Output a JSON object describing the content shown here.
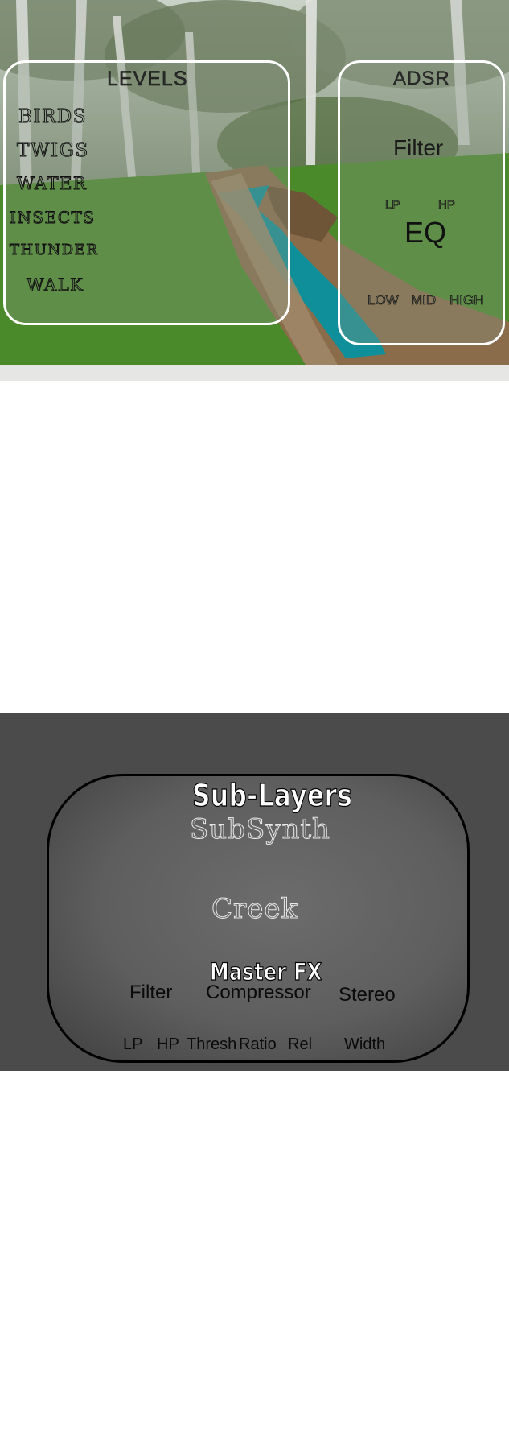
{
  "top_screen": {
    "levels": {
      "title": "LEVELS",
      "items": [
        "BIRDS",
        "TWIGS",
        "WATER",
        "INSECTS",
        "THUNDER",
        "WALK"
      ]
    },
    "adsr": {
      "title": "ADSR",
      "filter_label": "Filter",
      "lp_label": "LP",
      "hp_label": "HP",
      "eq_label": "EQ",
      "low_label": "LOW",
      "mid_label": "MID",
      "high_label": "HIGH"
    }
  },
  "bottom_screen": {
    "sub_layers_title": "Sub-Layers",
    "subsynth_label": "SubSynth",
    "creek_label": "Creek",
    "master_fx_title": "Master FX",
    "sections": {
      "filter": "Filter",
      "compressor": "Compressor",
      "stereo": "Stereo"
    },
    "params": {
      "lp": "LP",
      "hp": "HP",
      "thresh": "Thresh",
      "ratio": "Ratio",
      "rel": "Rel",
      "width": "Width"
    }
  },
  "colors": {
    "grass": "#4a8a2a",
    "water": "#0f8f9a",
    "path": "#a08868",
    "fx_background": "#4b4b4b"
  }
}
